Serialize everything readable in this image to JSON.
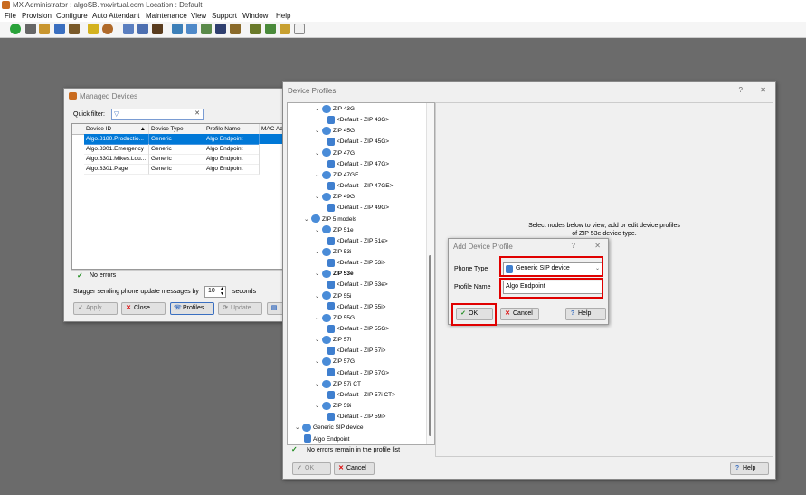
{
  "app": {
    "title": "MX Administrator : algoSB.mxvirtual.com   Location : Default",
    "menu": [
      "File",
      "Provision",
      "Configure",
      "Auto Attendant",
      "Maintenance",
      "View",
      "Support",
      "Window",
      "Help"
    ]
  },
  "managed_devices": {
    "title": "Managed Devices",
    "quick_filter_label": "Quick filter:",
    "columns": [
      "Device ID",
      "Device Type",
      "Profile Name",
      "MAC Ad"
    ],
    "rows": [
      [
        "Algo.8180.Productio...",
        "Generic",
        "Algo Endpoint",
        ""
      ],
      [
        "Algo.8301.Emergency",
        "Generic",
        "Algo Endpoint",
        ""
      ],
      [
        "Algo.8301.Mikes.Lou...",
        "Generic",
        "Algo Endpoint",
        ""
      ],
      [
        "Algo.8301.Page",
        "Generic",
        "Algo Endpoint",
        ""
      ]
    ],
    "status": "No errors",
    "stagger_label": "Stagger sending phone update messages by",
    "stagger_value": "10",
    "stagger_unit": "seconds",
    "buttons": {
      "apply": "Apply",
      "close": "Close",
      "profiles": "Profiles...",
      "update": "Update"
    }
  },
  "device_profiles": {
    "title": "Device Profiles",
    "tree": [
      {
        "label": "ZIP 43G",
        "level": 2,
        "kind": "model",
        "expanded": true
      },
      {
        "label": "<Default - ZIP 43G>",
        "level": 3,
        "kind": "profile"
      },
      {
        "label": "ZIP 45G",
        "level": 2,
        "kind": "model",
        "expanded": true
      },
      {
        "label": "<Default - ZIP 45G>",
        "level": 3,
        "kind": "profile"
      },
      {
        "label": "ZIP 47G",
        "level": 2,
        "kind": "model",
        "expanded": true
      },
      {
        "label": "<Default - ZIP 47G>",
        "level": 3,
        "kind": "profile"
      },
      {
        "label": "ZIP 47GE",
        "level": 2,
        "kind": "model",
        "expanded": true
      },
      {
        "label": "<Default - ZIP 47GE>",
        "level": 3,
        "kind": "profile"
      },
      {
        "label": "ZIP 49G",
        "level": 2,
        "kind": "model",
        "expanded": true
      },
      {
        "label": "<Default - ZIP 49G>",
        "level": 3,
        "kind": "profile"
      },
      {
        "label": "ZIP 5 models",
        "level": 1,
        "kind": "group",
        "expanded": true
      },
      {
        "label": "ZIP 51e",
        "level": 2,
        "kind": "model",
        "expanded": true
      },
      {
        "label": "<Default - ZIP 51e>",
        "level": 3,
        "kind": "profile"
      },
      {
        "label": "ZIP 53i",
        "level": 2,
        "kind": "model",
        "expanded": true
      },
      {
        "label": "<Default - ZIP 53i>",
        "level": 3,
        "kind": "profile"
      },
      {
        "label": "ZIP 53e",
        "level": 2,
        "kind": "model",
        "expanded": true,
        "bold": true
      },
      {
        "label": "<Default - ZIP 53e>",
        "level": 3,
        "kind": "profile"
      },
      {
        "label": "ZIP 55i",
        "level": 2,
        "kind": "model",
        "expanded": true
      },
      {
        "label": "<Default - ZIP 55i>",
        "level": 3,
        "kind": "profile"
      },
      {
        "label": "ZIP 55G",
        "level": 2,
        "kind": "model",
        "expanded": true
      },
      {
        "label": "<Default - ZIP 55G>",
        "level": 3,
        "kind": "profile"
      },
      {
        "label": "ZIP 57i",
        "level": 2,
        "kind": "model",
        "expanded": true
      },
      {
        "label": "<Default - ZIP 57i>",
        "level": 3,
        "kind": "profile"
      },
      {
        "label": "ZIP 57G",
        "level": 2,
        "kind": "model",
        "expanded": true
      },
      {
        "label": "<Default - ZIP 57G>",
        "level": 3,
        "kind": "profile"
      },
      {
        "label": "ZIP 57i CT",
        "level": 2,
        "kind": "model",
        "expanded": true
      },
      {
        "label": "<Default - ZIP 57i CT>",
        "level": 3,
        "kind": "profile"
      },
      {
        "label": "ZIP 59i",
        "level": 2,
        "kind": "model",
        "expanded": true
      },
      {
        "label": "<Default - ZIP 59i>",
        "level": 3,
        "kind": "profile"
      },
      {
        "label": "Generic SIP device",
        "level": 0,
        "kind": "group",
        "expanded": true
      },
      {
        "label": "Algo Endpoint",
        "level": 1,
        "kind": "profile"
      }
    ],
    "hint_line1": "Select nodes below to view, add or edit device profiles",
    "hint_line2": "of ZIP 53e device type.",
    "status": "No errors remain in the profile list",
    "buttons": {
      "ok": "OK",
      "cancel": "Cancel",
      "help": "Help"
    },
    "title_buttons": {
      "help": "?",
      "close": "✕"
    }
  },
  "add_profile": {
    "title": "Add Device Profile",
    "phone_type_label": "Phone Type",
    "phone_type_value": "Generic SIP device",
    "profile_name_label": "Profile Name",
    "profile_name_value": "Algo Endpoint",
    "buttons": {
      "ok": "OK",
      "cancel": "Cancel",
      "help": "Help"
    },
    "title_buttons": {
      "help": "?",
      "close": "✕"
    }
  },
  "colors": {
    "accent": "#0078d7",
    "highlight": "#e00000",
    "selection": "#0078d7"
  }
}
